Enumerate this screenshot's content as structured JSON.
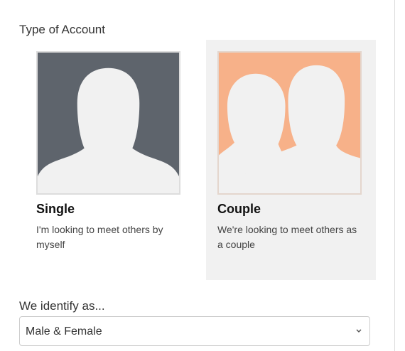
{
  "account_type": {
    "label": "Type of Account",
    "options": [
      {
        "title": "Single",
        "description": "I'm looking to meet others by myself",
        "icon": "single-person-silhouette-icon",
        "selected": false
      },
      {
        "title": "Couple",
        "description": "We're looking to meet others as a couple",
        "icon": "couple-silhouette-icon",
        "selected": true
      }
    ]
  },
  "identify": {
    "label": "We identify as...",
    "selected_value": "Male & Female",
    "icon": "chevron-down-icon"
  },
  "colors": {
    "single_background": "#5e646c",
    "couple_background": "#f7b189",
    "selected_card_background": "#f1f1f1",
    "silhouette": "#f1f1f1"
  }
}
